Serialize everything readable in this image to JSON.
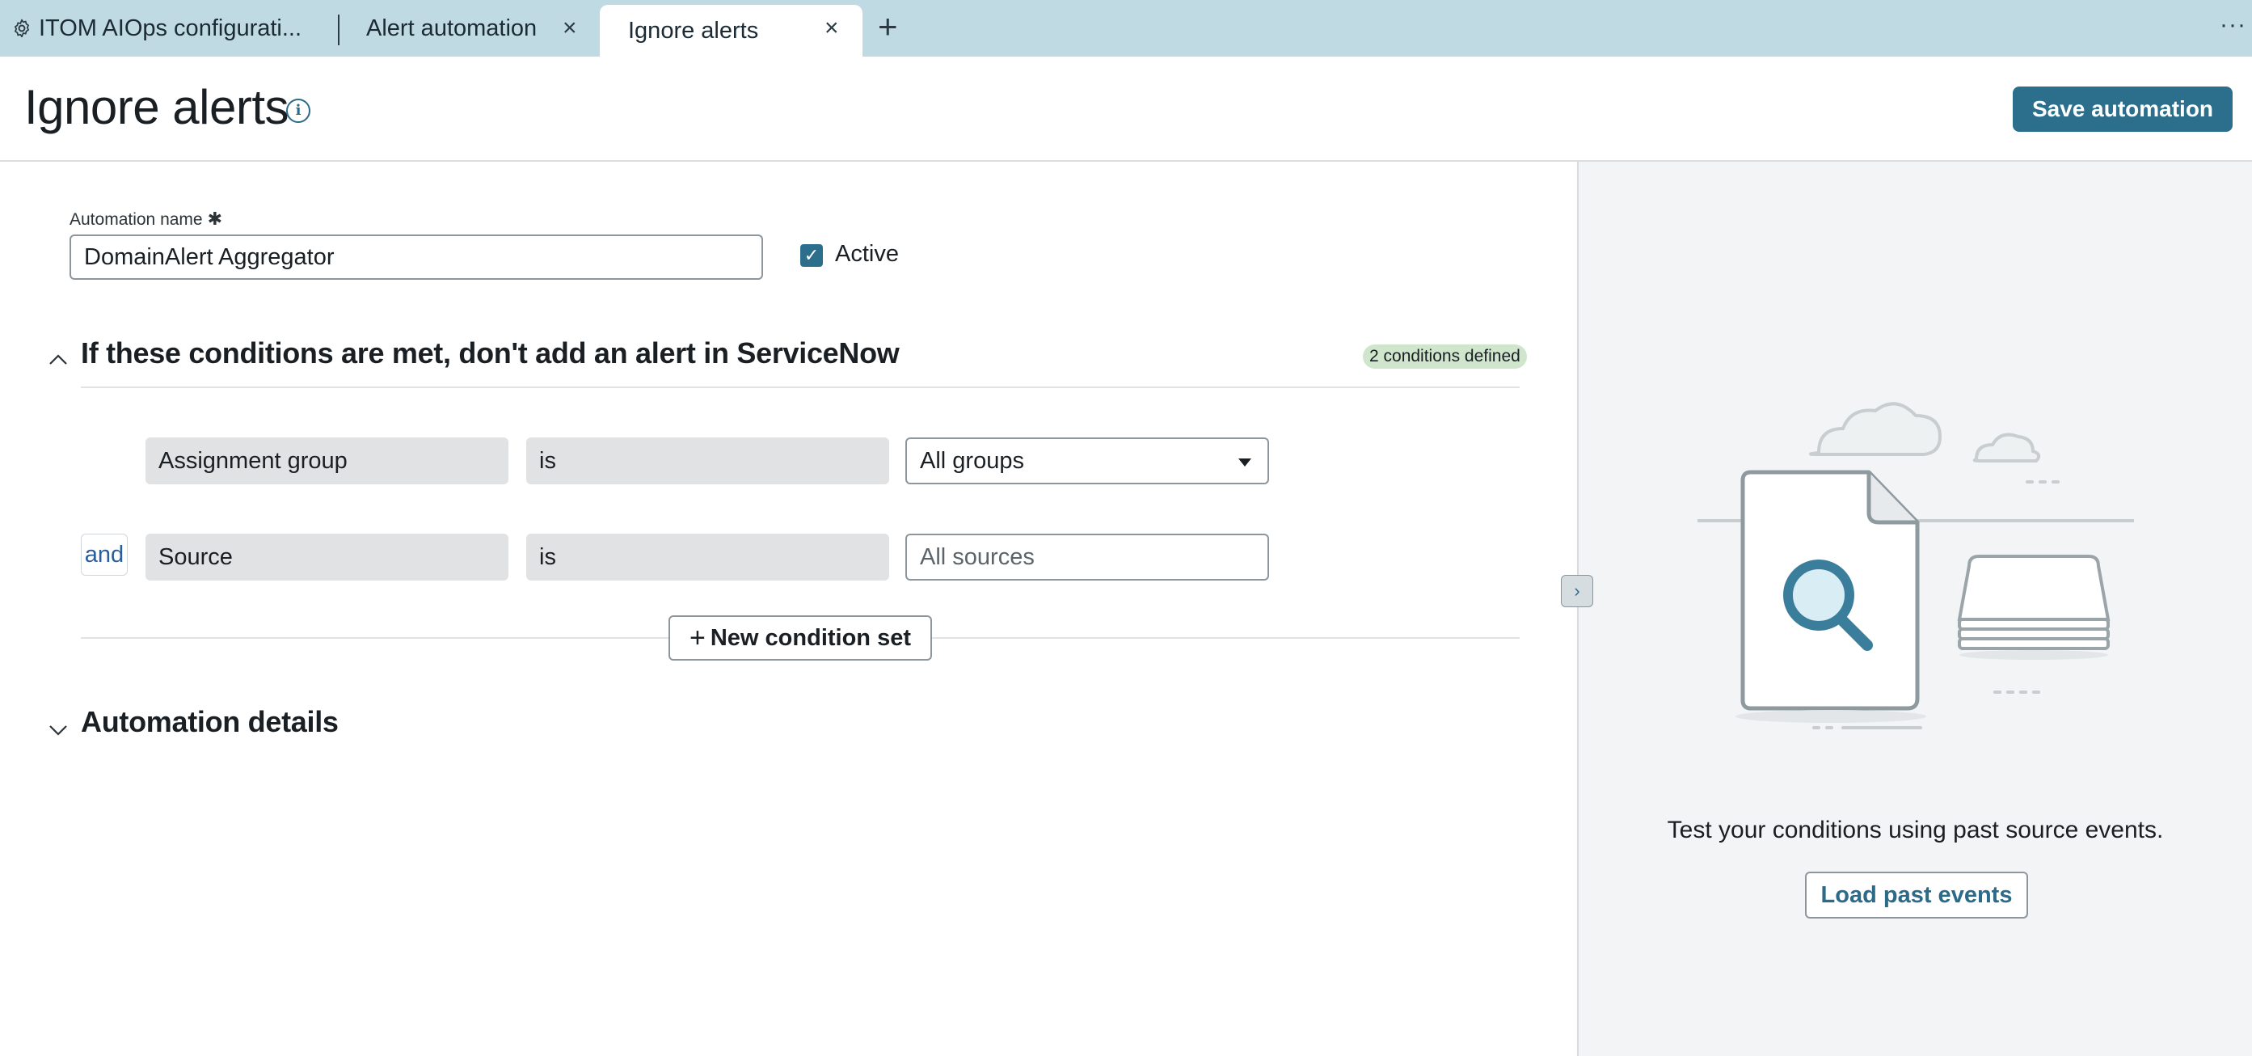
{
  "tabs": [
    {
      "label": "ITOM AIOps configurati...",
      "icon": "gear-icon"
    },
    {
      "label": "Alert automation",
      "closable": true
    },
    {
      "label": "Ignore alerts",
      "closable": true,
      "active": true
    }
  ],
  "header": {
    "title": "Ignore alerts",
    "save_label": "Save automation"
  },
  "form": {
    "name_label": "Automation name",
    "name_value": "DomainAlert Aggregator",
    "active_label": "Active",
    "active_checked": true
  },
  "conditions_section": {
    "title": "If these conditions are met, don't add an alert in ServiceNow",
    "badge": "2 conditions defined",
    "conditions": [
      {
        "field": "Assignment group",
        "operator": "is",
        "value": "All groups",
        "value_type": "select"
      },
      {
        "connector": "and",
        "field": "Source",
        "operator": "is",
        "placeholder": "All sources",
        "value_type": "input"
      }
    ],
    "new_condition_label": "New condition set"
  },
  "details_section": {
    "title": "Automation details"
  },
  "side_panel": {
    "test_text": "Test your conditions using past source events.",
    "load_label": "Load past events"
  },
  "colors": {
    "tab_bar": "#bfdae3",
    "primary": "#2c6f8c",
    "badge_bg": "#cfe5cc",
    "panel_bg": "#f2f4f5"
  }
}
